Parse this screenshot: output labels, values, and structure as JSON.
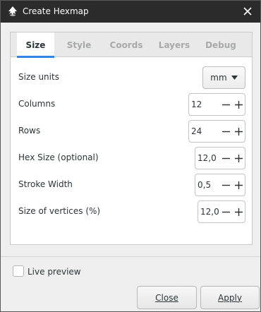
{
  "window": {
    "title": "Create Hexmap",
    "app_icon": "inkscape-icon",
    "close_icon": "close-icon"
  },
  "tabs": [
    {
      "label": "Size",
      "active": true
    },
    {
      "label": "Style",
      "active": false
    },
    {
      "label": "Coords",
      "active": false
    },
    {
      "label": "Layers",
      "active": false
    },
    {
      "label": "Debug",
      "active": false
    }
  ],
  "size_tab": {
    "size_units": {
      "label": "Size units",
      "value": "mm"
    },
    "columns": {
      "label": "Columns",
      "value": "12"
    },
    "rows": {
      "label": "Rows",
      "value": "24"
    },
    "hex_size": {
      "label": "Hex Size (optional)",
      "value": "12,0"
    },
    "stroke_width": {
      "label": "Stroke Width",
      "value": "0,5"
    },
    "vertices_size": {
      "label": "Size of vertices (%)",
      "value": "12,0"
    }
  },
  "footer": {
    "live_preview": {
      "label": "Live preview",
      "checked": false
    },
    "close_label": "Close",
    "apply_label": "Apply"
  },
  "colors": {
    "titlebar": "#2b2b2b",
    "accent": "#3584e4",
    "active_tab": "#ffffff"
  }
}
